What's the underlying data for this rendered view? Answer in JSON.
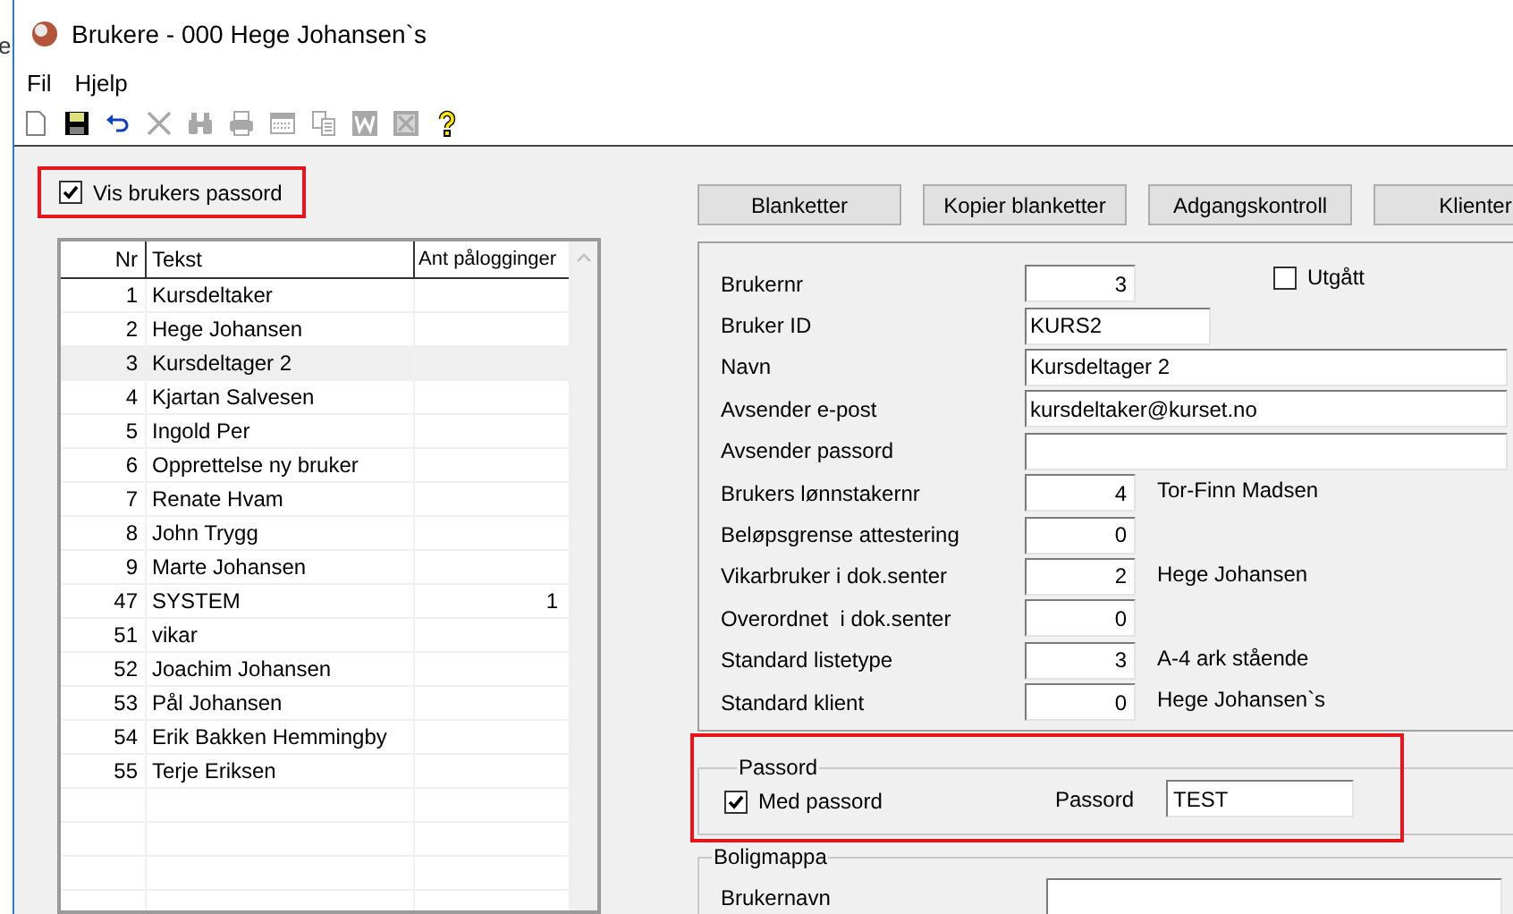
{
  "background_window": {
    "text": "e"
  },
  "window": {
    "title": "Brukere - 000 Hege Johansen`s"
  },
  "menu": [
    "Fil",
    "Hjelp"
  ],
  "toolbar": [
    {
      "kind": "new",
      "disabled": false
    },
    {
      "kind": "save",
      "disabled": false
    },
    {
      "kind": "undo",
      "disabled": false
    },
    {
      "kind": "delete",
      "disabled": true
    },
    {
      "kind": "find",
      "disabled": true
    },
    {
      "kind": "print",
      "disabled": true
    },
    {
      "kind": "calendar",
      "disabled": true
    },
    {
      "kind": "copy",
      "disabled": true
    },
    {
      "kind": "word",
      "disabled": true
    },
    {
      "kind": "excel",
      "disabled": true
    },
    {
      "kind": "help",
      "disabled": false
    }
  ],
  "show_password": {
    "label": "Vis brukers passord",
    "checked": true
  },
  "list": {
    "columns": [
      "Nr",
      "Tekst",
      "Ant pålogginger"
    ],
    "rows": [
      {
        "nr": "1",
        "text": "Kursdeltaker",
        "selected": false
      },
      {
        "nr": "2",
        "text": "Hege Johansen",
        "selected": false
      },
      {
        "nr": "3",
        "text": "Kursdeltager 2",
        "selected": true
      },
      {
        "nr": "4",
        "text": "Kjartan Salvesen",
        "selected": false
      },
      {
        "nr": "5",
        "text": "Ingold Per",
        "selected": false
      },
      {
        "nr": "6",
        "text": "Opprettelse ny bruker",
        "selected": false
      },
      {
        "nr": "7",
        "text": "Renate Hvam",
        "selected": false
      },
      {
        "nr": "8",
        "text": "John Trygg",
        "selected": false
      },
      {
        "nr": "9",
        "text": "Marte Johansen",
        "selected": false
      },
      {
        "nr": "47",
        "text": "SYSTEM",
        "logins": "1",
        "selected": false
      },
      {
        "nr": "51",
        "text": "vikar",
        "selected": false
      },
      {
        "nr": "52",
        "text": "Joachim Johansen",
        "selected": false
      },
      {
        "nr": "53",
        "text": "Pål Johansen",
        "selected": false
      },
      {
        "nr": "54",
        "text": "Erik Bakken Hemmingby",
        "selected": false
      },
      {
        "nr": "55",
        "text": "Terje Eriksen",
        "selected": false
      }
    ]
  },
  "buttons": [
    "Blanketter",
    "Kopier blanketter",
    "Adgangskontroll",
    "Klienter"
  ],
  "fields": [
    {
      "label": "Brukernr",
      "value": "3",
      "kind": "number"
    },
    {
      "label": "Bruker ID",
      "value": "KURS2",
      "kind": "short"
    },
    {
      "label": "Navn",
      "value": "Kursdeltager 2",
      "kind": "wide"
    },
    {
      "label": "Avsender e-post",
      "value": "kursdeltaker@kurset.no",
      "kind": "wide"
    },
    {
      "label": "Avsender passord",
      "kind": "wide"
    },
    {
      "label": "Brukers lønnstakernr",
      "value": "4",
      "kind": "number",
      "note": "Tor-Finn Madsen"
    },
    {
      "label": "Beløpsgrense attestering",
      "value": "0",
      "kind": "number"
    },
    {
      "label": "Vikarbruker i dok.senter",
      "value": "2",
      "kind": "number",
      "note": "Hege Johansen"
    },
    {
      "label": "Overordnet  i dok.senter",
      "value": "0",
      "kind": "number"
    },
    {
      "label": "Standard listetype",
      "value": "3",
      "kind": "number",
      "note": "A-4 ark stående"
    },
    {
      "label": "Standard klient",
      "value": "0",
      "kind": "number",
      "note": "Hege Johansen`s"
    }
  ],
  "expired": {
    "label": "Utgått",
    "checked": false
  },
  "password_group": {
    "title": "Passord",
    "checkbox": {
      "label": "Med passord",
      "checked": true
    },
    "field_label": "Passord",
    "value": "TEST"
  },
  "home_folder": {
    "title": "Boligmappa",
    "fields": [
      {
        "label": "Brukernavn"
      }
    ]
  }
}
